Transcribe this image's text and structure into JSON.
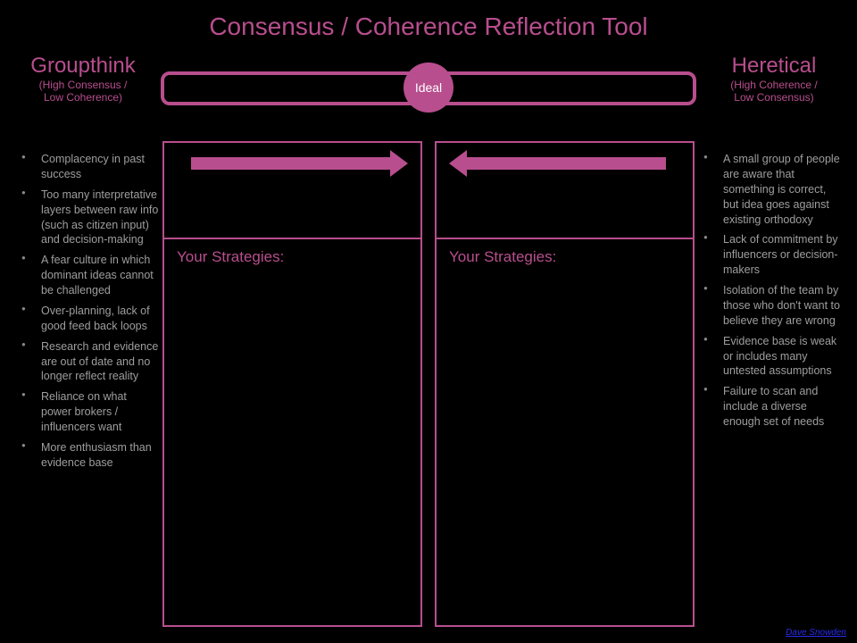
{
  "title": "Consensus / Coherence Reflection Tool",
  "ideal_label": "Ideal",
  "corners": {
    "left": {
      "title": "Groupthink",
      "sub1": "(High Consensus /",
      "sub2": "Low Coherence)"
    },
    "right": {
      "title": "Heretical",
      "sub1": "(High Coherence /",
      "sub2": "Low Consensus)"
    }
  },
  "left_list": [
    "Complacency in past success",
    "Too many interpretative layers between raw info (such as citizen input) and decision-making",
    "A fear culture in which dominant ideas cannot be challenged",
    "Over-planning, lack of good feed back loops",
    "Research and evidence are out of date and no longer reflect reality",
    "Reliance on what power brokers / influencers want",
    "More enthusiasm than evidence base"
  ],
  "right_list": [
    "A small group of people are aware that something is correct, but idea goes against existing orthodoxy",
    "Lack of commitment by influencers or decision-makers",
    "Isolation of the team by those who don't want to believe they are wrong",
    "Evidence base is weak or includes many untested assumptions",
    "Failure to scan and include a diverse enough set of needs"
  ],
  "panels": {
    "left_label": "Your Strategies:",
    "right_label": "Your Strategies:"
  },
  "credit": "Dave Snowden",
  "colors": {
    "accent": "#b84e8e",
    "grey": "#9e9e9e",
    "link": "#2a2af0",
    "bg": "#000000"
  }
}
